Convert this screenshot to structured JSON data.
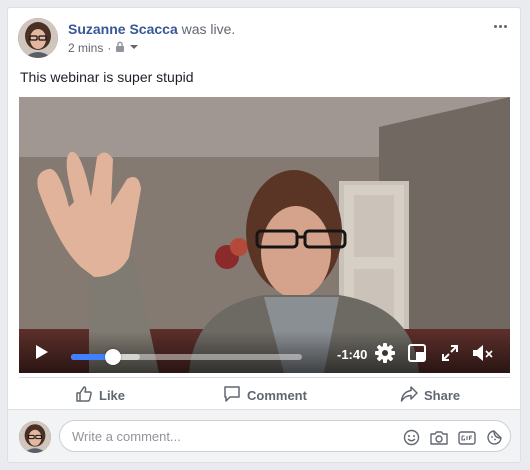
{
  "post": {
    "author": "Suzanne Scacca",
    "status": "was live.",
    "time": "2 mins",
    "separator": "·",
    "text": "This webinar is super stupid"
  },
  "video": {
    "remaining_time": "-1:40",
    "progress_fraction": 0.18,
    "buffered_fraction": 0.3,
    "accent_color": "#4080ff"
  },
  "actions": {
    "like": "Like",
    "comment": "Comment",
    "share": "Share"
  },
  "comment_box": {
    "placeholder": "Write a comment..."
  },
  "icons": {
    "privacy": "lock-icon",
    "audience_menu": "caret-down-icon",
    "more": "more-options-icon",
    "settings": "gear-icon",
    "pip": "picture-in-picture-icon",
    "fullscreen": "fullscreen-icon",
    "mute": "muted-speaker-icon",
    "emoji": "emoji-icon",
    "camera": "camera-icon",
    "gif": "gif-icon",
    "sticker": "sticker-icon"
  },
  "colors": {
    "author_link": "#365899",
    "secondary_text": "#616770",
    "page_background": "#e9ebee"
  }
}
